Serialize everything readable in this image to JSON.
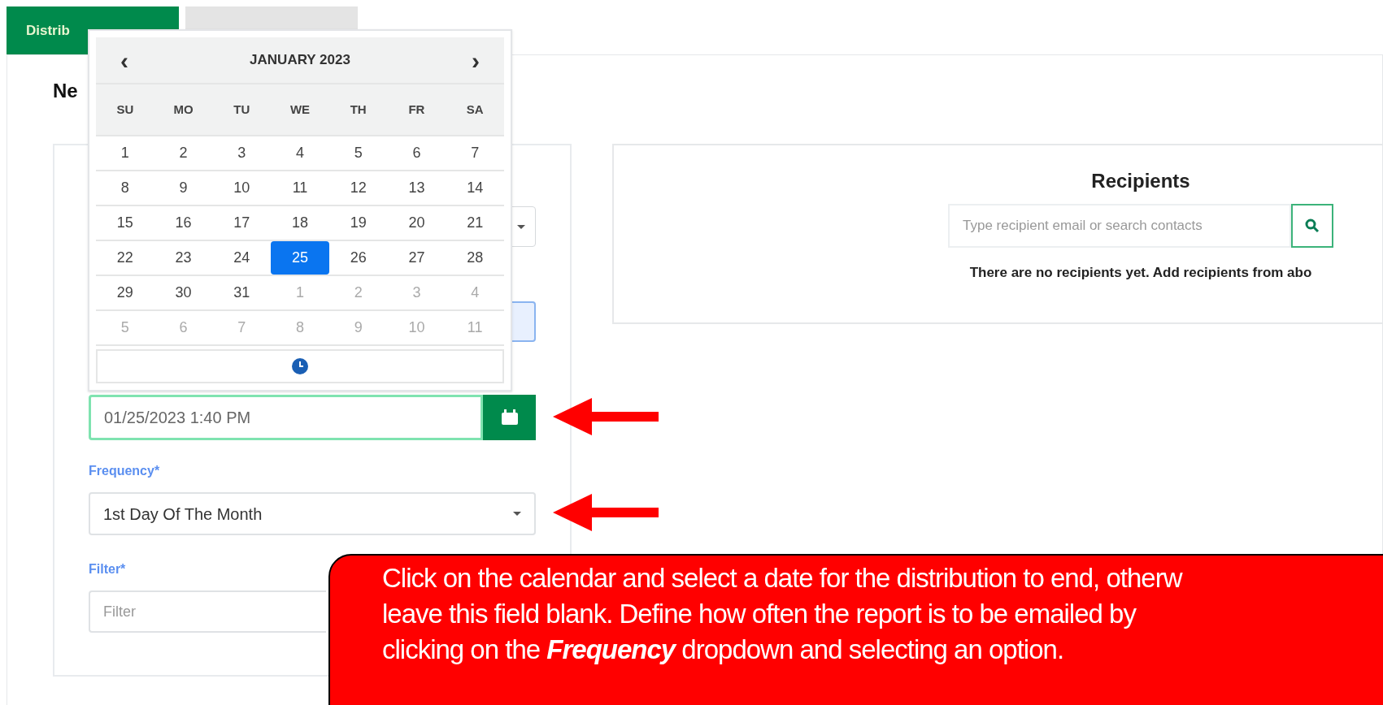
{
  "tabs": [
    {
      "label": "Distrib",
      "selected": true
    },
    {
      "selected": false
    }
  ],
  "heading": "Ne",
  "calendar": {
    "title": "JANUARY 2023",
    "prev": "‹",
    "next": "›",
    "weekdays": [
      "SU",
      "MO",
      "TU",
      "WE",
      "TH",
      "FR",
      "SA"
    ],
    "weeks": [
      [
        {
          "label": "1",
          "outside": false,
          "selected": false
        },
        {
          "label": "2",
          "outside": false,
          "selected": false
        },
        {
          "label": "3",
          "outside": false,
          "selected": false
        },
        {
          "label": "4",
          "outside": false,
          "selected": false
        },
        {
          "label": "5",
          "outside": false,
          "selected": false
        },
        {
          "label": "6",
          "outside": false,
          "selected": false
        },
        {
          "label": "7",
          "outside": false,
          "selected": false
        }
      ],
      [
        {
          "label": "8",
          "outside": false,
          "selected": false
        },
        {
          "label": "9",
          "outside": false,
          "selected": false
        },
        {
          "label": "10",
          "outside": false,
          "selected": false
        },
        {
          "label": "11",
          "outside": false,
          "selected": false
        },
        {
          "label": "12",
          "outside": false,
          "selected": false
        },
        {
          "label": "13",
          "outside": false,
          "selected": false
        },
        {
          "label": "14",
          "outside": false,
          "selected": false
        }
      ],
      [
        {
          "label": "15",
          "outside": false,
          "selected": false
        },
        {
          "label": "16",
          "outside": false,
          "selected": false
        },
        {
          "label": "17",
          "outside": false,
          "selected": false
        },
        {
          "label": "18",
          "outside": false,
          "selected": false
        },
        {
          "label": "19",
          "outside": false,
          "selected": false
        },
        {
          "label": "20",
          "outside": false,
          "selected": false
        },
        {
          "label": "21",
          "outside": false,
          "selected": false
        }
      ],
      [
        {
          "label": "22",
          "outside": false,
          "selected": false
        },
        {
          "label": "23",
          "outside": false,
          "selected": false
        },
        {
          "label": "24",
          "outside": false,
          "selected": false
        },
        {
          "label": "25",
          "outside": false,
          "selected": true
        },
        {
          "label": "26",
          "outside": false,
          "selected": false
        },
        {
          "label": "27",
          "outside": false,
          "selected": false
        },
        {
          "label": "28",
          "outside": false,
          "selected": false
        }
      ],
      [
        {
          "label": "29",
          "outside": false,
          "selected": false
        },
        {
          "label": "30",
          "outside": false,
          "selected": false
        },
        {
          "label": "31",
          "outside": false,
          "selected": false
        },
        {
          "label": "1",
          "outside": true,
          "selected": false
        },
        {
          "label": "2",
          "outside": true,
          "selected": false
        },
        {
          "label": "3",
          "outside": true,
          "selected": false
        },
        {
          "label": "4",
          "outside": true,
          "selected": false
        }
      ],
      [
        {
          "label": "5",
          "outside": true,
          "selected": false
        },
        {
          "label": "6",
          "outside": true,
          "selected": false
        },
        {
          "label": "7",
          "outside": true,
          "selected": false
        },
        {
          "label": "8",
          "outside": true,
          "selected": false
        },
        {
          "label": "9",
          "outside": true,
          "selected": false
        },
        {
          "label": "10",
          "outside": true,
          "selected": false
        },
        {
          "label": "11",
          "outside": true,
          "selected": false
        }
      ]
    ]
  },
  "end_date": {
    "value": "01/25/2023 1:40 PM"
  },
  "frequency": {
    "label": "Frequency*",
    "value": "1st Day Of The Month"
  },
  "filter": {
    "label": "Filter*",
    "placeholder": "Filter"
  },
  "recipients": {
    "title": "Recipients",
    "placeholder": "Type recipient email or search contacts",
    "empty": "There are no recipients yet. Add recipients from abo"
  },
  "callout": {
    "lines": [
      "Click on the calendar and select a date for the distribution to end, otherw",
      "leave this field blank.  Define how often the report is to be emailed by",
      "clicking on the **Frequency** dropdown and selecting an option."
    ]
  }
}
